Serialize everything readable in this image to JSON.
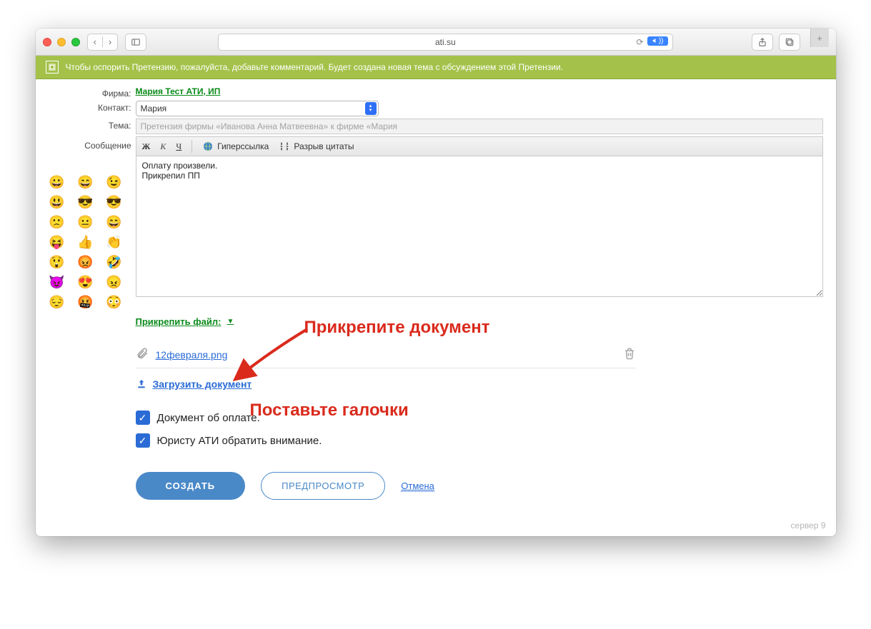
{
  "browser": {
    "url": "ati.su"
  },
  "banner": {
    "text": "Чтобы оспорить Претензию, пожалуйста, добавьте комментарий. Будет создана новая тема с обсуждением этой Претензии."
  },
  "labels": {
    "firm": "Фирма:",
    "contact": "Контакт:",
    "topic": "Тема:",
    "message": "Сообщение"
  },
  "firm_link": "Мария Тест АТИ, ИП",
  "contact_value": "Мария",
  "topic_value": "Претензия фирмы «Иванова Анна Матвеевна» к фирме «Мария",
  "toolbar": {
    "bold": "Ж",
    "italic": "К",
    "underline": "Ч",
    "link": "Гиперссылка",
    "break": "Разрыв цитаты"
  },
  "message_text": "Оплату произвели.\nПрикрепил ПП",
  "attach": {
    "toggle": "Прикрепить файл:",
    "file_name": "12февраля.png",
    "upload": "Загрузить документ"
  },
  "checks": {
    "c1": "Документ об оплате.",
    "c2": "Юристу АТИ обратить внимание."
  },
  "buttons": {
    "create": "СОЗДАТЬ",
    "preview": "ПРЕДПРОСМОТР",
    "cancel": "Отмена"
  },
  "server": "сервер 9",
  "annotations": {
    "a1": "Прикрепите документ",
    "a2": "Поставьте галочки"
  },
  "emoji": [
    "😀",
    "😄",
    "😉",
    "😃",
    "😎",
    "😎",
    "🙁",
    "😐",
    "😄",
    "😝",
    "👍",
    "👏",
    "😲",
    "😡",
    "🤣",
    "😈",
    "😍",
    "😠",
    "😔",
    "🤬",
    "😳"
  ]
}
